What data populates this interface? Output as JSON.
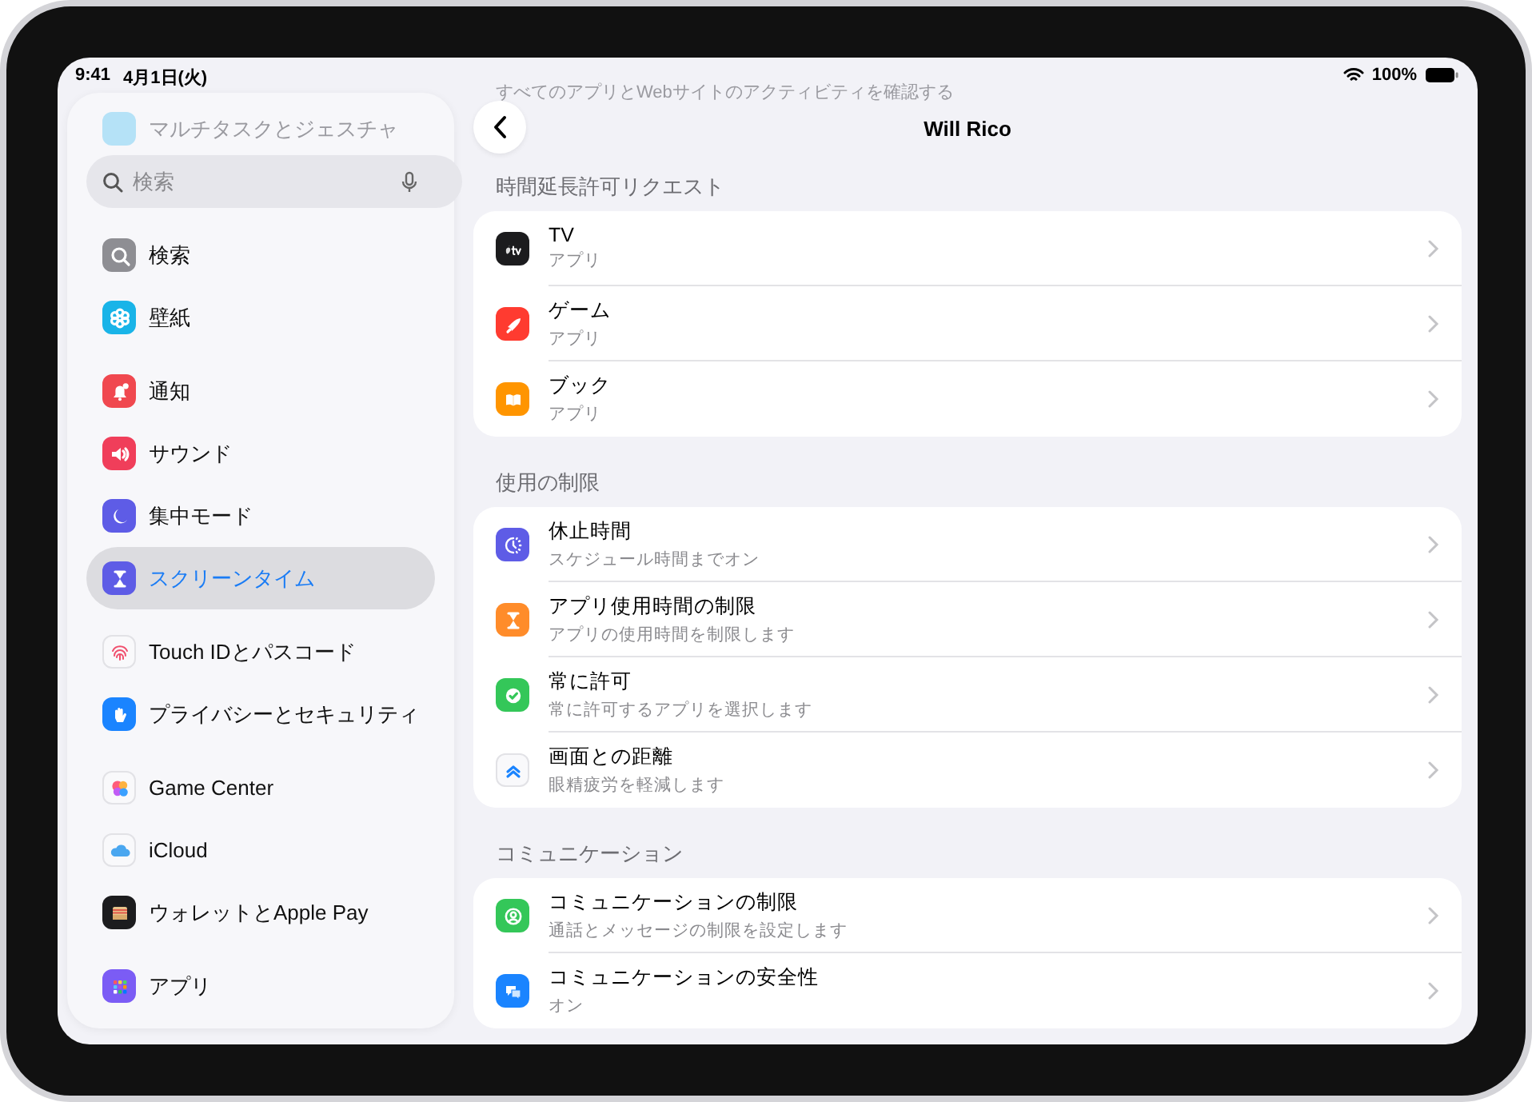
{
  "status_bar": {
    "time": "9:41",
    "date": "4月1日(火)",
    "battery": "100%"
  },
  "sidebar": {
    "faded_item": "マルチタスクとジェスチャ",
    "search": {
      "placeholder": "検索"
    },
    "groups": [
      {
        "items": [
          {
            "label": "検索",
            "selected": false
          },
          {
            "label": "壁紙",
            "selected": false
          }
        ]
      },
      {
        "items": [
          {
            "label": "通知",
            "selected": false
          },
          {
            "label": "サウンド",
            "selected": false
          },
          {
            "label": "集中モード",
            "selected": false
          },
          {
            "label": "スクリーンタイム",
            "selected": true
          }
        ]
      },
      {
        "items": [
          {
            "label": "Touch IDとパスコード",
            "selected": false
          },
          {
            "label": "プライバシーとセキュリティ",
            "selected": false
          }
        ]
      },
      {
        "items": [
          {
            "label": "Game Center",
            "selected": false
          },
          {
            "label": "iCloud",
            "selected": false
          },
          {
            "label": "ウォレットとApple Pay",
            "selected": false
          }
        ]
      },
      {
        "items": [
          {
            "label": "アプリ",
            "selected": false
          }
        ]
      }
    ]
  },
  "detail": {
    "faded_text": "すべてのアプリとWebサイトのアクティビティを確認する",
    "title": "Will Rico",
    "sections": [
      {
        "header": "時間延長許可リクエスト",
        "rows": [
          {
            "title": "TV",
            "subtitle": "アプリ"
          },
          {
            "title": "ゲーム",
            "subtitle": "アプリ"
          },
          {
            "title": "ブック",
            "subtitle": "アプリ"
          }
        ]
      },
      {
        "header": "使用の制限",
        "rows": [
          {
            "title": "休止時間",
            "subtitle": "スケジュール時間までオン"
          },
          {
            "title": "アプリ使用時間の制限",
            "subtitle": "アプリの使用時間を制限します"
          },
          {
            "title": "常に許可",
            "subtitle": "常に許可するアプリを選択します"
          },
          {
            "title": "画面との距離",
            "subtitle": "眼精疲労を軽減します"
          }
        ]
      },
      {
        "header": "コミュニケーション",
        "rows": [
          {
            "title": "コミュニケーションの制限",
            "subtitle": "通話とメッセージの制限を設定します"
          },
          {
            "title": "コミュニケーションの安全性",
            "subtitle": "オン"
          }
        ]
      }
    ]
  }
}
